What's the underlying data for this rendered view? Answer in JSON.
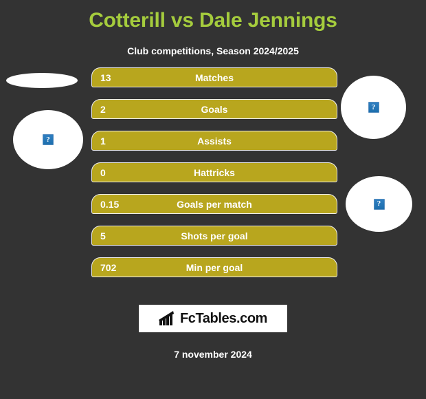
{
  "colors": {
    "background": "#333333",
    "title_green": "#a5cc3d",
    "bar_fill": "#b8a61e",
    "bar_border": "#f2f2f2",
    "text_white": "#ffffff",
    "logo_bg": "#ffffff",
    "logo_text": "#111111"
  },
  "header": {
    "title": "Cotterill vs Dale Jennings",
    "subtitle": "Club competitions, Season 2024/2025"
  },
  "players": {
    "left": {
      "photo_top": "broken-image-placeholder",
      "photo_main": "broken-image-placeholder",
      "placeholder_glyph": "?"
    },
    "right": {
      "photo_top": "broken-image-placeholder",
      "photo_main": "broken-image-placeholder",
      "placeholder_glyph": "?"
    }
  },
  "stats": [
    {
      "value": "13",
      "label": "Matches"
    },
    {
      "value": "2",
      "label": "Goals"
    },
    {
      "value": "1",
      "label": "Assists"
    },
    {
      "value": "0",
      "label": "Hattricks"
    },
    {
      "value": "0.15",
      "label": "Goals per match"
    },
    {
      "value": "5",
      "label": "Shots per goal"
    },
    {
      "value": "702",
      "label": "Min per goal"
    }
  ],
  "footer": {
    "logo_text": "FcTables.com",
    "logo_icon": "bar-chart-icon",
    "date": "7 november 2024"
  }
}
